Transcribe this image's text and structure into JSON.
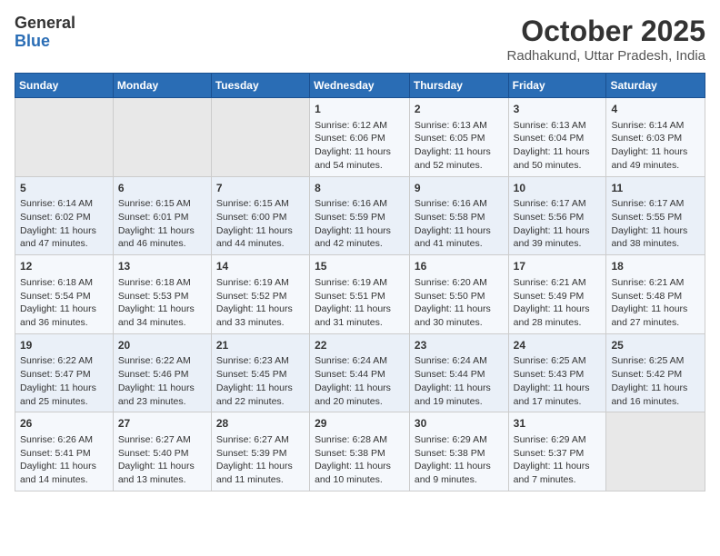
{
  "header": {
    "logo_general": "General",
    "logo_blue": "Blue",
    "month_year": "October 2025",
    "location": "Radhakund, Uttar Pradesh, India"
  },
  "weekdays": [
    "Sunday",
    "Monday",
    "Tuesday",
    "Wednesday",
    "Thursday",
    "Friday",
    "Saturday"
  ],
  "weeks": [
    [
      {
        "day": "",
        "sunrise": "",
        "sunset": "",
        "daylight": ""
      },
      {
        "day": "",
        "sunrise": "",
        "sunset": "",
        "daylight": ""
      },
      {
        "day": "",
        "sunrise": "",
        "sunset": "",
        "daylight": ""
      },
      {
        "day": "1",
        "sunrise": "Sunrise: 6:12 AM",
        "sunset": "Sunset: 6:06 PM",
        "daylight": "Daylight: 11 hours and 54 minutes."
      },
      {
        "day": "2",
        "sunrise": "Sunrise: 6:13 AM",
        "sunset": "Sunset: 6:05 PM",
        "daylight": "Daylight: 11 hours and 52 minutes."
      },
      {
        "day": "3",
        "sunrise": "Sunrise: 6:13 AM",
        "sunset": "Sunset: 6:04 PM",
        "daylight": "Daylight: 11 hours and 50 minutes."
      },
      {
        "day": "4",
        "sunrise": "Sunrise: 6:14 AM",
        "sunset": "Sunset: 6:03 PM",
        "daylight": "Daylight: 11 hours and 49 minutes."
      }
    ],
    [
      {
        "day": "5",
        "sunrise": "Sunrise: 6:14 AM",
        "sunset": "Sunset: 6:02 PM",
        "daylight": "Daylight: 11 hours and 47 minutes."
      },
      {
        "day": "6",
        "sunrise": "Sunrise: 6:15 AM",
        "sunset": "Sunset: 6:01 PM",
        "daylight": "Daylight: 11 hours and 46 minutes."
      },
      {
        "day": "7",
        "sunrise": "Sunrise: 6:15 AM",
        "sunset": "Sunset: 6:00 PM",
        "daylight": "Daylight: 11 hours and 44 minutes."
      },
      {
        "day": "8",
        "sunrise": "Sunrise: 6:16 AM",
        "sunset": "Sunset: 5:59 PM",
        "daylight": "Daylight: 11 hours and 42 minutes."
      },
      {
        "day": "9",
        "sunrise": "Sunrise: 6:16 AM",
        "sunset": "Sunset: 5:58 PM",
        "daylight": "Daylight: 11 hours and 41 minutes."
      },
      {
        "day": "10",
        "sunrise": "Sunrise: 6:17 AM",
        "sunset": "Sunset: 5:56 PM",
        "daylight": "Daylight: 11 hours and 39 minutes."
      },
      {
        "day": "11",
        "sunrise": "Sunrise: 6:17 AM",
        "sunset": "Sunset: 5:55 PM",
        "daylight": "Daylight: 11 hours and 38 minutes."
      }
    ],
    [
      {
        "day": "12",
        "sunrise": "Sunrise: 6:18 AM",
        "sunset": "Sunset: 5:54 PM",
        "daylight": "Daylight: 11 hours and 36 minutes."
      },
      {
        "day": "13",
        "sunrise": "Sunrise: 6:18 AM",
        "sunset": "Sunset: 5:53 PM",
        "daylight": "Daylight: 11 hours and 34 minutes."
      },
      {
        "day": "14",
        "sunrise": "Sunrise: 6:19 AM",
        "sunset": "Sunset: 5:52 PM",
        "daylight": "Daylight: 11 hours and 33 minutes."
      },
      {
        "day": "15",
        "sunrise": "Sunrise: 6:19 AM",
        "sunset": "Sunset: 5:51 PM",
        "daylight": "Daylight: 11 hours and 31 minutes."
      },
      {
        "day": "16",
        "sunrise": "Sunrise: 6:20 AM",
        "sunset": "Sunset: 5:50 PM",
        "daylight": "Daylight: 11 hours and 30 minutes."
      },
      {
        "day": "17",
        "sunrise": "Sunrise: 6:21 AM",
        "sunset": "Sunset: 5:49 PM",
        "daylight": "Daylight: 11 hours and 28 minutes."
      },
      {
        "day": "18",
        "sunrise": "Sunrise: 6:21 AM",
        "sunset": "Sunset: 5:48 PM",
        "daylight": "Daylight: 11 hours and 27 minutes."
      }
    ],
    [
      {
        "day": "19",
        "sunrise": "Sunrise: 6:22 AM",
        "sunset": "Sunset: 5:47 PM",
        "daylight": "Daylight: 11 hours and 25 minutes."
      },
      {
        "day": "20",
        "sunrise": "Sunrise: 6:22 AM",
        "sunset": "Sunset: 5:46 PM",
        "daylight": "Daylight: 11 hours and 23 minutes."
      },
      {
        "day": "21",
        "sunrise": "Sunrise: 6:23 AM",
        "sunset": "Sunset: 5:45 PM",
        "daylight": "Daylight: 11 hours and 22 minutes."
      },
      {
        "day": "22",
        "sunrise": "Sunrise: 6:24 AM",
        "sunset": "Sunset: 5:44 PM",
        "daylight": "Daylight: 11 hours and 20 minutes."
      },
      {
        "day": "23",
        "sunrise": "Sunrise: 6:24 AM",
        "sunset": "Sunset: 5:44 PM",
        "daylight": "Daylight: 11 hours and 19 minutes."
      },
      {
        "day": "24",
        "sunrise": "Sunrise: 6:25 AM",
        "sunset": "Sunset: 5:43 PM",
        "daylight": "Daylight: 11 hours and 17 minutes."
      },
      {
        "day": "25",
        "sunrise": "Sunrise: 6:25 AM",
        "sunset": "Sunset: 5:42 PM",
        "daylight": "Daylight: 11 hours and 16 minutes."
      }
    ],
    [
      {
        "day": "26",
        "sunrise": "Sunrise: 6:26 AM",
        "sunset": "Sunset: 5:41 PM",
        "daylight": "Daylight: 11 hours and 14 minutes."
      },
      {
        "day": "27",
        "sunrise": "Sunrise: 6:27 AM",
        "sunset": "Sunset: 5:40 PM",
        "daylight": "Daylight: 11 hours and 13 minutes."
      },
      {
        "day": "28",
        "sunrise": "Sunrise: 6:27 AM",
        "sunset": "Sunset: 5:39 PM",
        "daylight": "Daylight: 11 hours and 11 minutes."
      },
      {
        "day": "29",
        "sunrise": "Sunrise: 6:28 AM",
        "sunset": "Sunset: 5:38 PM",
        "daylight": "Daylight: 11 hours and 10 minutes."
      },
      {
        "day": "30",
        "sunrise": "Sunrise: 6:29 AM",
        "sunset": "Sunset: 5:38 PM",
        "daylight": "Daylight: 11 hours and 9 minutes."
      },
      {
        "day": "31",
        "sunrise": "Sunrise: 6:29 AM",
        "sunset": "Sunset: 5:37 PM",
        "daylight": "Daylight: 11 hours and 7 minutes."
      },
      {
        "day": "",
        "sunrise": "",
        "sunset": "",
        "daylight": ""
      }
    ]
  ]
}
